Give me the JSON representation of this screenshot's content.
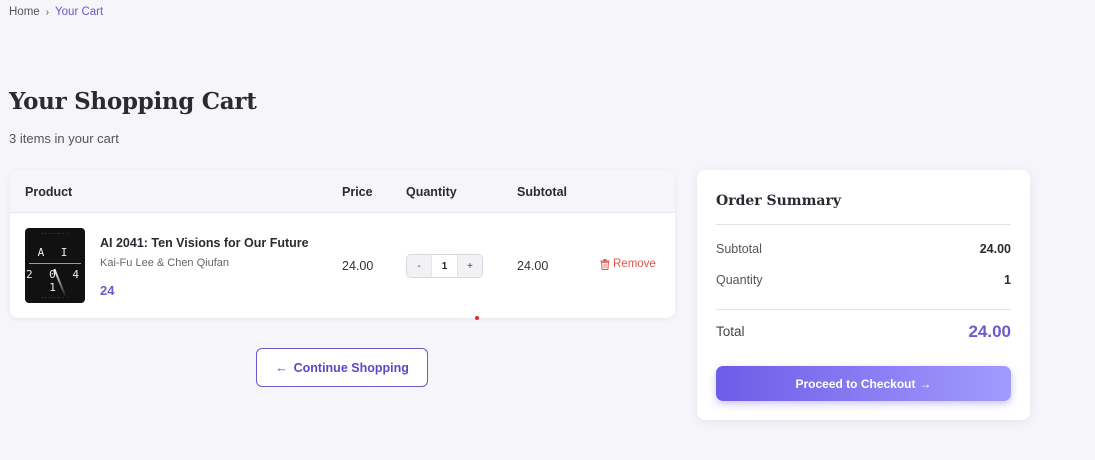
{
  "breadcrumb": {
    "home": "Home",
    "separator": "›",
    "current": "Your Cart"
  },
  "page": {
    "title": "Your Shopping Cart",
    "item_count": "3 items in your cart"
  },
  "cart": {
    "columns": {
      "product": "Product",
      "price": "Price",
      "quantity": "Quantity",
      "subtotal": "Subtotal"
    },
    "items": [
      {
        "cover_text_top": "A I",
        "cover_text_bottom": "2 0 4 1",
        "title": "AI 2041: Ten Visions for Our Future",
        "author": "Kai-Fu Lee & Chen Qiufan",
        "price_tag": "24",
        "price": "24.00",
        "quantity": "1",
        "subtotal": "24.00",
        "remove_label": "Remove",
        "decrement_label": "-",
        "increment_label": "+"
      }
    ]
  },
  "continue_button": {
    "label": "Continue Shopping",
    "icon": "arrow-left-icon"
  },
  "summary": {
    "title": "Order Summary",
    "subtotal_label": "Subtotal",
    "subtotal_value": "24.00",
    "quantity_label": "Quantity",
    "quantity_value": "1",
    "total_label": "Total",
    "total_value": "24.00",
    "checkout_label": "Proceed to Checkout",
    "checkout_icon": "arrow-right-icon"
  },
  "colors": {
    "accent": "#6a5acd",
    "remove": "#e0574a",
    "background": "#f5f5fa",
    "checkout_gradient_start": "#6c5ce7",
    "checkout_gradient_end": "#a29bfe"
  }
}
